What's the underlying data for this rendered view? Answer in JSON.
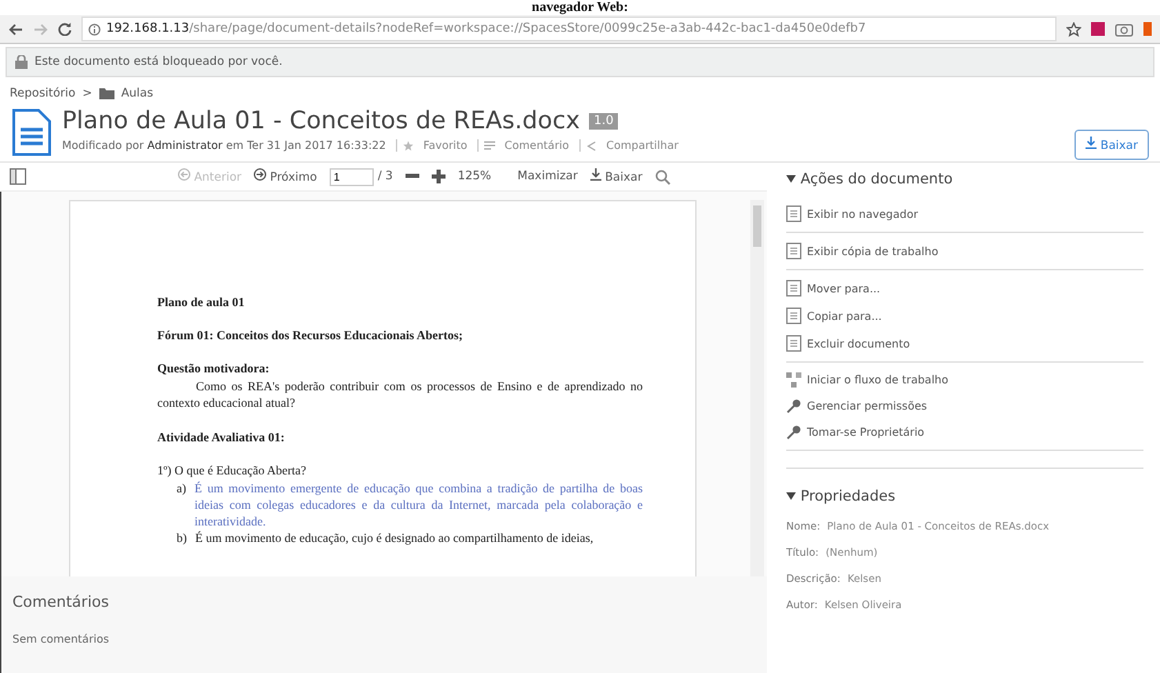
{
  "caption": "navegador Web:",
  "browser": {
    "host": "192.168.1.13",
    "path": "/share/page/document-details?nodeRef=workspace://SpacesStore/0099c25e-a3ab-442c-bac1-da450e0defb7"
  },
  "lock_notice": "Este documento está bloqueado por você.",
  "breadcrumb": [
    {
      "label": "Repositório",
      "kind": "link"
    },
    {
      "label": ">",
      "kind": "sep"
    },
    {
      "label": "Aulas",
      "kind": "folder"
    }
  ],
  "document": {
    "title": "Plano de Aula 01 - Conceitos de REAs.docx",
    "version": "1.0",
    "modified": "Modificado por **Administrator** em Ter 31 Jan 2017 16:33:22",
    "actions": [
      {
        "label": "Favorito",
        "kind": "star"
      },
      {
        "label": "Comentário",
        "kind": "comment"
      },
      {
        "label": "Compartilhar",
        "kind": "share"
      }
    ]
  },
  "download_button": "Baixar",
  "viewer": {
    "prev": {
      "label": "Anterior",
      "disabled": true
    },
    "next": {
      "label": "Próximo",
      "disabled": false
    },
    "page": "1",
    "total": "/ 3",
    "zoom": "125%",
    "maximize": "Maximizar",
    "download": "Baixar"
  },
  "page_content": [
    {
      "kind": "heading",
      "text": "Plano de aula 01"
    },
    {
      "kind": "heading",
      "text": "Fórum 01: Conceitos dos Recursos Educacionais Abertos;"
    },
    {
      "kind": "heading",
      "text": "Questão motivadora:"
    },
    {
      "kind": "para",
      "text": "Como os REA's poderão contribuir com os processos de Ensino e de aprendizado no contexto educacional atual?"
    },
    {
      "kind": "heading",
      "text": "Atividade Avaliativa 01:"
    },
    {
      "kind": "question",
      "text": "1º) O que é Educação Aberta?"
    },
    {
      "kind": "item",
      "marker": "a)",
      "text": "É um movimento emergente de educação que combina a tradição de partilha de boas ideias com colegas educadores e da cultura da Internet, marcada pela colaboração e interatividade.",
      "highlight": true
    },
    {
      "kind": "item",
      "marker": "b)",
      "text": "É um movimento de educação, cujo é designado ao compartilhamento de ideias,",
      "highlight": false
    }
  ],
  "comments": {
    "title": "Comentários",
    "empty": "Sem comentários"
  },
  "actions_panel": {
    "title": "Ações do documento",
    "expanded": true,
    "groups": [
      [
        {
          "label": "Exibir no navegador",
          "kind": "browser"
        }
      ],
      [
        {
          "label": "Exibir cópia de trabalho",
          "kind": "edit"
        }
      ],
      [
        {
          "label": "Mover para...",
          "kind": "doc"
        },
        {
          "label": "Copiar para...",
          "kind": "doc"
        },
        {
          "label": "Excluir documento",
          "kind": "delete"
        }
      ],
      [
        {
          "label": "Iniciar o fluxo de trabalho",
          "kind": "workflow"
        },
        {
          "label": "Gerenciar permissões",
          "kind": "key"
        },
        {
          "label": "Tomar-se Proprietário",
          "kind": "key"
        }
      ]
    ]
  },
  "properties": {
    "title": "Propriedades",
    "expanded": true,
    "items": [
      {
        "label": "Nome:",
        "value": "Plano de Aula 01 - Conceitos de REAs.docx"
      },
      {
        "label": "Título:",
        "value": "(Nenhum)"
      },
      {
        "label": "Descrição:",
        "value": "Kelsen"
      },
      {
        "label": "Autor:",
        "value": "Kelsen Oliveira"
      }
    ]
  }
}
